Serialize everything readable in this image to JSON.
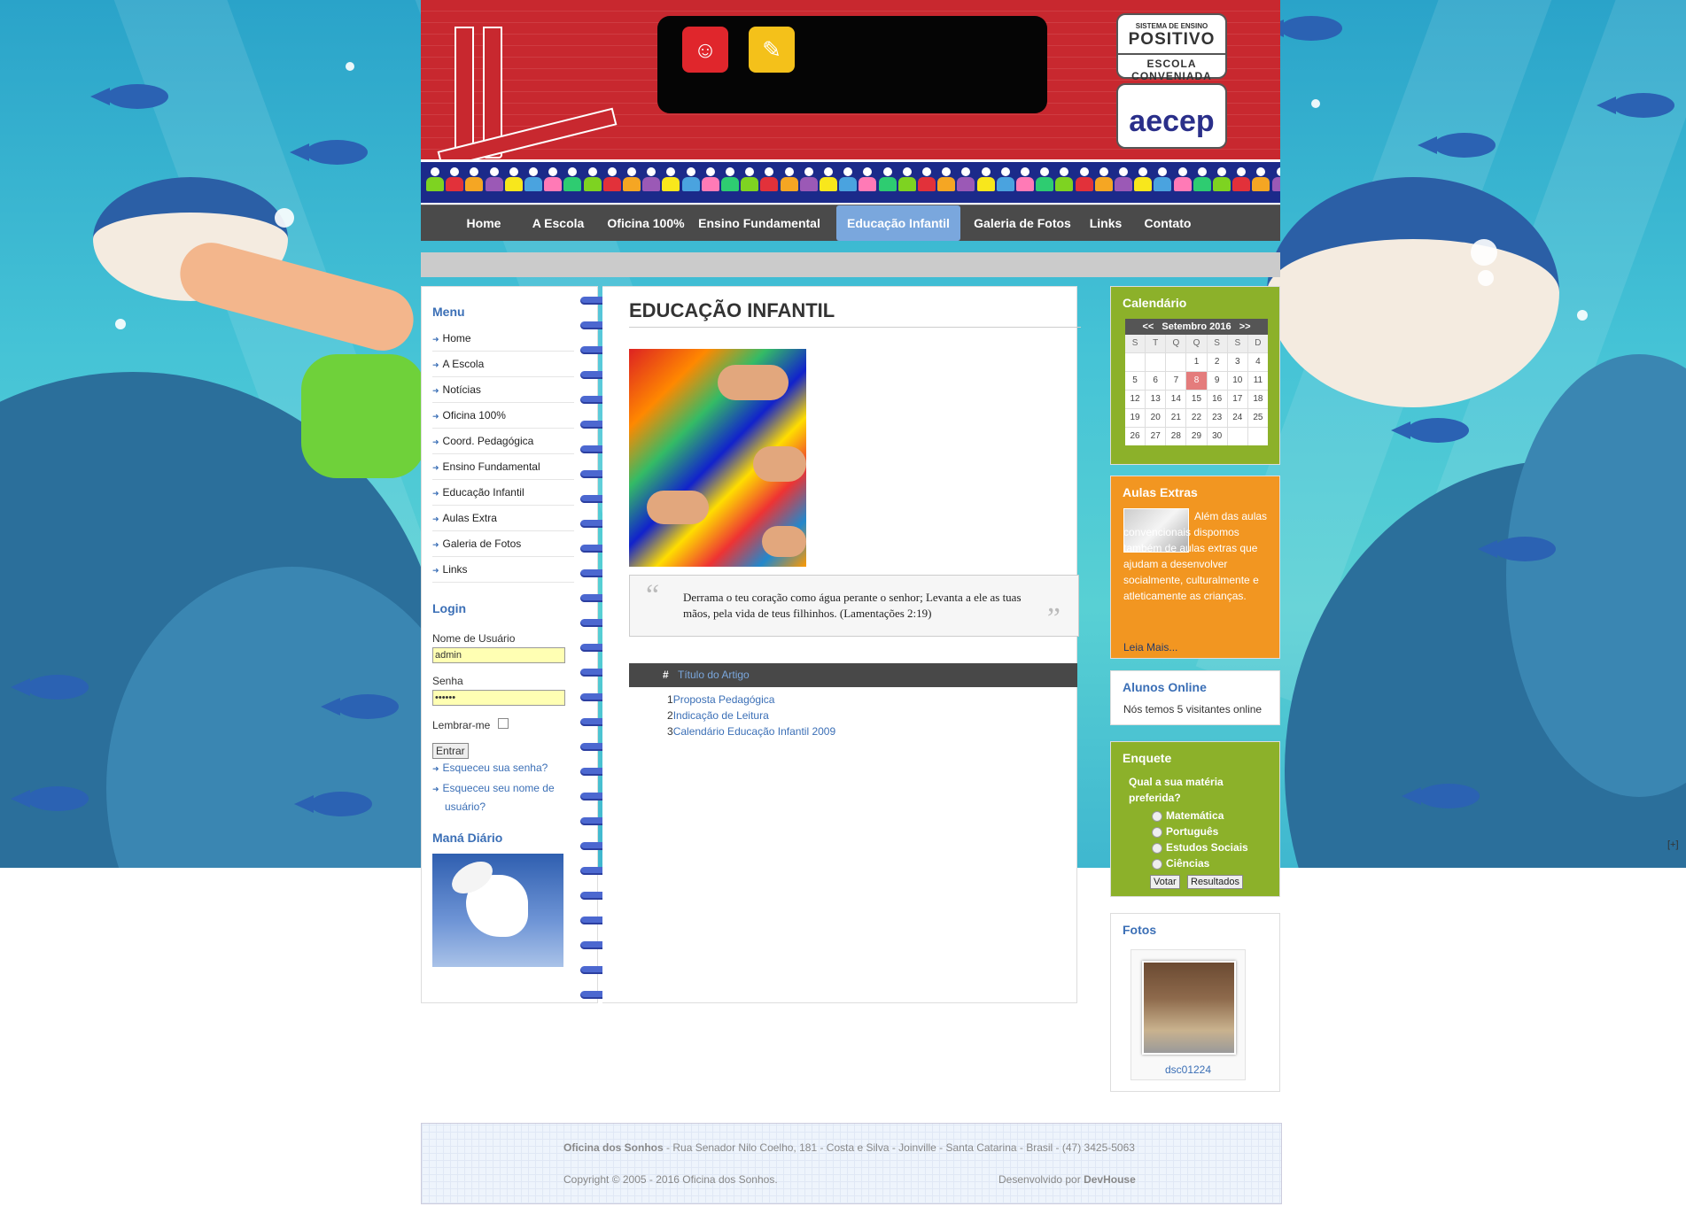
{
  "nav": {
    "items": [
      "Home",
      "A Escola",
      "Oficina 100%",
      "Ensino Fundamental",
      "Educação Infantil",
      "Galeria de Fotos",
      "Links",
      "Contato"
    ],
    "active": "Educação Infantil"
  },
  "logos": {
    "positivo_top": "SISTEMA DE ENSINO",
    "positivo_name": "POSITIVO",
    "positivo_bottom": "ESCOLA CONVENIADA",
    "aecep": "aecep"
  },
  "left": {
    "menu_title": "Menu",
    "menu_items": [
      "Home",
      "A Escola",
      "Notícias",
      "Oficina 100%",
      "Coord. Pedagógica",
      "Ensino Fundamental",
      "Educação Infantil",
      "Aulas Extra",
      "Galeria de Fotos",
      "Links"
    ],
    "login_title": "Login",
    "username_label": "Nome de Usuário",
    "username_value": "admin",
    "password_label": "Senha",
    "password_value": "••••••",
    "remember_label": "Lembrar-me",
    "submit_label": "Entrar",
    "forgot_password": "Esqueceu sua senha?",
    "forgot_username": "Esqueceu seu nome de usuário?",
    "mana_title": "Maná Diário"
  },
  "main": {
    "title": "EDUCAÇÃO INFANTIL",
    "quote": "Derrama o teu coração como água perante o senhor; Levanta a ele as tuas mãos, pela vida de teus filhinhos. (Lamentações 2:19)",
    "table_hash": "#",
    "table_col": "Título do Artigo",
    "rows": [
      {
        "num": "1",
        "title": "Proposta Pedagógica"
      },
      {
        "num": "2",
        "title": "Indicação de Leitura"
      },
      {
        "num": "3",
        "title": "Calendário Educação Infantil 2009"
      }
    ]
  },
  "right": {
    "calendar_title": "Calendário",
    "calendar_prev": "<<",
    "calendar_month": "Setembro 2016",
    "calendar_next": ">>",
    "calendar_dow": [
      "S",
      "T",
      "Q",
      "Q",
      "S",
      "S",
      "D"
    ],
    "calendar_days": [
      "",
      "",
      "",
      "1",
      "2",
      "3",
      "4",
      "5",
      "6",
      "7",
      "8",
      "9",
      "10",
      "11",
      "12",
      "13",
      "14",
      "15",
      "16",
      "17",
      "18",
      "19",
      "20",
      "21",
      "22",
      "23",
      "24",
      "25",
      "26",
      "27",
      "28",
      "29",
      "30",
      "",
      ""
    ],
    "calendar_today": "8",
    "aulas_title": "Aulas Extras",
    "aulas_text": "Além das aulas convencionais dispomos também de aulas extras que ajudam a desenvolver socialmente, culturalmente e atleticamente as crianças.",
    "aulas_more": "Leia Mais...",
    "online_title": "Alunos Online",
    "online_text": "Nós temos 5 visitantes online",
    "poll_title": "Enquete",
    "poll_question": "Qual a sua matéria preferida?",
    "poll_options": [
      "Matemática",
      "Português",
      "Estudos Sociais",
      "Ciências"
    ],
    "poll_vote": "Votar",
    "poll_results": "Resultados",
    "photos_title": "Fotos",
    "photo_caption": "dsc01224"
  },
  "footer": {
    "school": "Oficina dos Sonhos",
    "address": " - Rua Senador Nilo Coelho, 181 - Costa e Silva - Joinville - Santa Catarina - Brasil - (47) 3425-5063",
    "copyright": "Copyright © 2005 - 2016 Oficina dos Sonhos.",
    "dev_prefix": "Desenvolvido por ",
    "dev_name": "DevHouse"
  },
  "misc": {
    "expand": "[+]"
  },
  "colors": {
    "header_red": "#c8282f",
    "nav_gray": "#4a4a4a",
    "nav_active": "#7aa7dd",
    "green": "#8cb12a",
    "orange": "#f29621",
    "link_blue": "#3b6fb6"
  }
}
